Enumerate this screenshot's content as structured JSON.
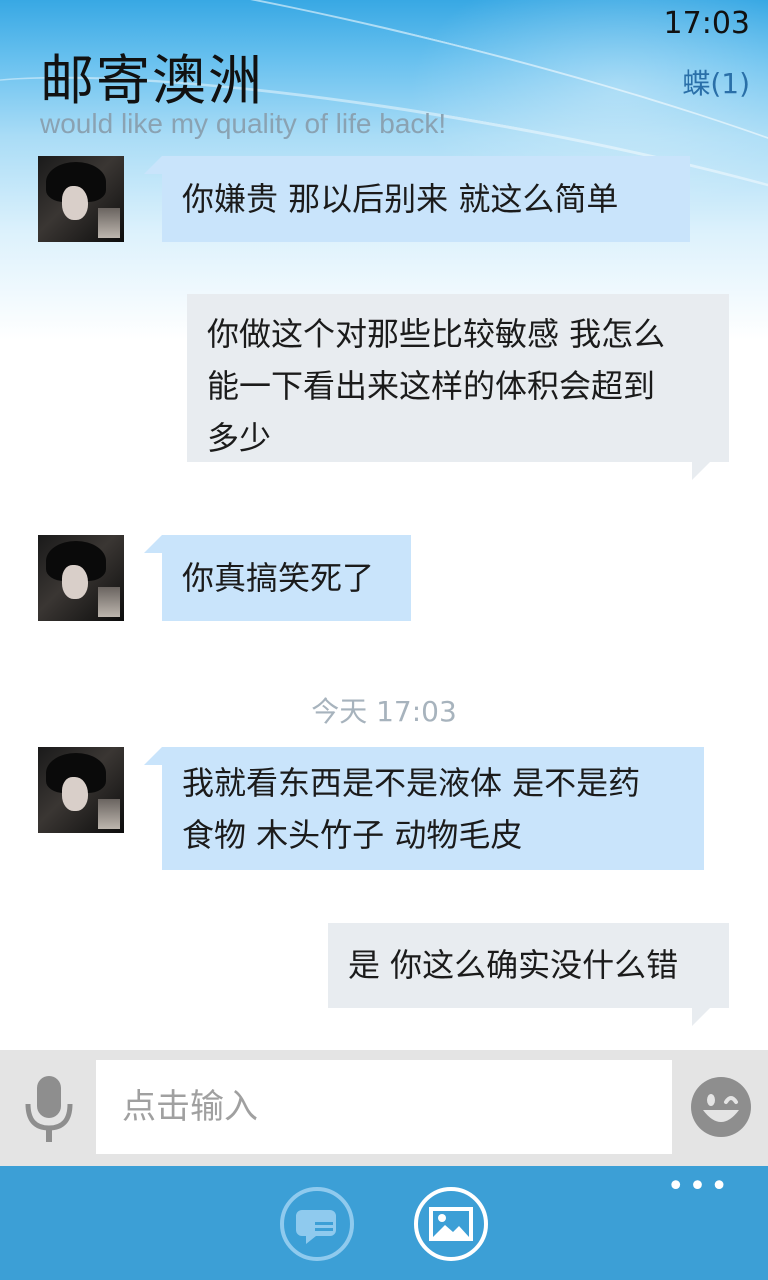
{
  "status": {
    "time": "17:03"
  },
  "header": {
    "title": "邮寄澳洲",
    "subtitle": "would like my quality of life back!",
    "notification": "蝶(1)"
  },
  "messages": [
    {
      "direction": "in",
      "text": "你嫌贵 那以后别来 就这么简单"
    },
    {
      "direction": "out",
      "text": "你做这个对那些比较敏感 我怎么\n能一下看出来这样的体积会超到\n多少"
    },
    {
      "direction": "in",
      "text": "你真搞笑死了"
    },
    {
      "direction": "in",
      "text": "我就看东西是不是液体 是不是药\n食物 木头竹子 动物毛皮"
    },
    {
      "direction": "out",
      "text": "是 你这么确实没什么错"
    }
  ],
  "separator": {
    "label": "今天 17:03"
  },
  "composer": {
    "placeholder": "点击输入",
    "mic_icon": "microphone-icon",
    "emoji_icon": "smiley-icon"
  },
  "appbar": {
    "buttons": [
      {
        "icon": "chat-bubble-icon"
      },
      {
        "icon": "image-icon"
      }
    ],
    "more_label": "•••"
  },
  "colors": {
    "bubble_in": "#c9e4fb",
    "bubble_out": "#e8ecf0",
    "appbar": "#3c9fd6",
    "input_bar": "#e4e4e4"
  }
}
